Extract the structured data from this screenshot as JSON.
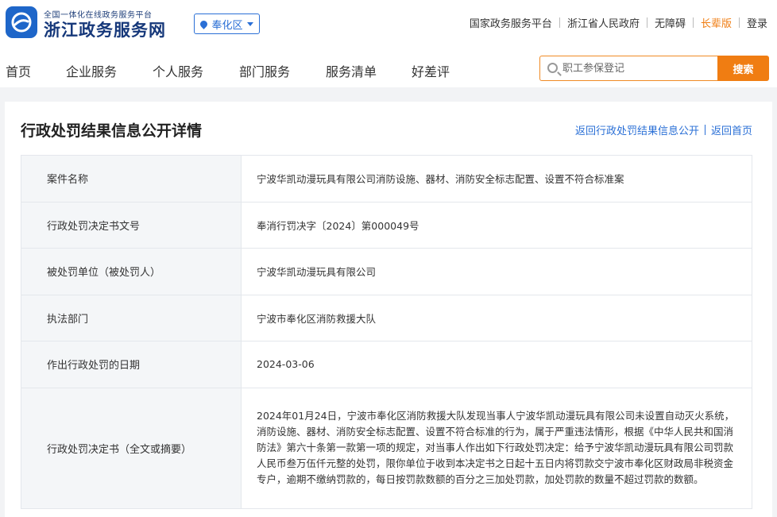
{
  "header": {
    "logo_sub": "全国一体化在线政务服务平台",
    "logo_main": "浙江政务服务网",
    "region": "奉化区",
    "top_links": [
      {
        "label": "国家政务服务平台",
        "highlight": false
      },
      {
        "label": "浙江省人民政府",
        "highlight": false
      },
      {
        "label": "无障碍",
        "highlight": false
      },
      {
        "label": "长辈版",
        "highlight": true
      },
      {
        "label": "登录",
        "highlight": false
      }
    ]
  },
  "nav": {
    "items": [
      "首页",
      "企业服务",
      "个人服务",
      "部门服务",
      "服务清单",
      "好差评"
    ],
    "search_placeholder": "职工参保登记",
    "search_button": "搜索"
  },
  "page": {
    "title": "行政处罚结果信息公开详情",
    "back_list": "返回行政处罚结果信息公开",
    "back_home": "返回首页"
  },
  "details": [
    {
      "label": "案件名称",
      "value": "宁波华凯动漫玩具有限公司消防设施、器材、消防安全标志配置、设置不符合标准案"
    },
    {
      "label": "行政处罚决定书文号",
      "value": "奉消行罚决字〔2024〕第000049号"
    },
    {
      "label": "被处罚单位（被处罚人）",
      "value": "宁波华凯动漫玩具有限公司"
    },
    {
      "label": "执法部门",
      "value": "宁波市奉化区消防救援大队"
    },
    {
      "label": "作出行政处罚的日期",
      "value": "2024-03-06"
    },
    {
      "label": "行政处罚决定书（全文或摘要）",
      "value": "2024年01月24日，宁波市奉化区消防救援大队发现当事人宁波华凯动漫玩具有限公司未设置自动灭火系统，消防设施、器材、消防安全标志配置、设置不符合标准的行为，属于严重违法情形，根据《中华人民共和国消防法》第六十条第一款第一项的规定，对当事人作出如下行政处罚决定：给予宁波华凯动漫玩具有限公司罚款人民币叁万伍仟元整的处罚，限你单位于收到本决定书之日起十五日内将罚款交宁波市奉化区财政局非税资金专户，逾期不缴纳罚款的，每日按罚款数额的百分之三加处罚款，加处罚款的数量不超过罚款的数额。"
    }
  ]
}
